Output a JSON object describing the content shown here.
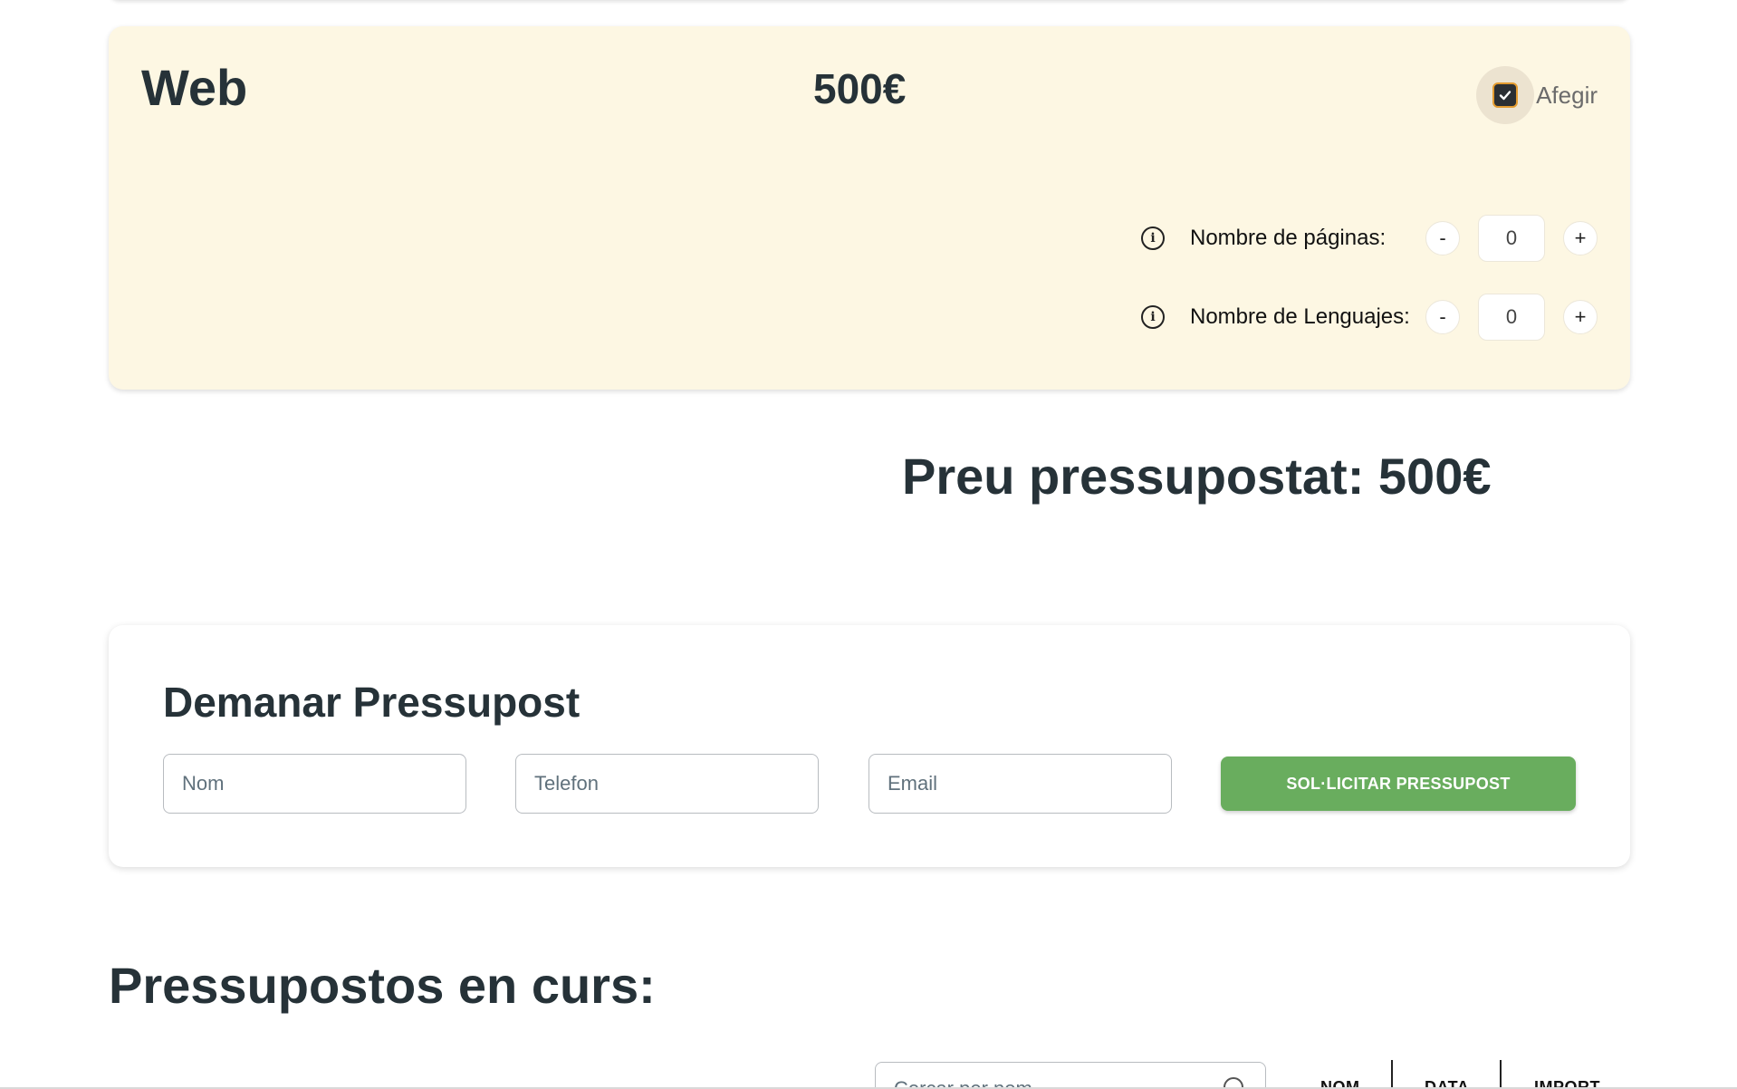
{
  "service": {
    "title": "Web",
    "price": "500€",
    "add_label": "Afegir",
    "add_checked": true,
    "options": [
      {
        "label": "Nombre de páginas:",
        "value": "0",
        "minus": "-",
        "plus": "+"
      },
      {
        "label": "Nombre de Lenguajes:",
        "value": "0",
        "minus": "-",
        "plus": "+"
      }
    ]
  },
  "total": {
    "text": "Preu pressupostat: 500€"
  },
  "request": {
    "title": "Demanar Pressupost",
    "name_placeholder": "Nom",
    "phone_placeholder": "Telefon",
    "email_placeholder": "Email",
    "submit_label": "SOL·LICITAR PRESSUPOST"
  },
  "budgets": {
    "title": "Pressupostos en curs:",
    "search_placeholder": "Cercar per nom",
    "sort_labels": [
      "NOM",
      "DATA",
      "IMPORT"
    ]
  },
  "colors": {
    "card_bg": "#fdf7e3",
    "submit_bg": "#69ad5e",
    "checkbox_border": "#e39b2f",
    "text": "#263238"
  }
}
